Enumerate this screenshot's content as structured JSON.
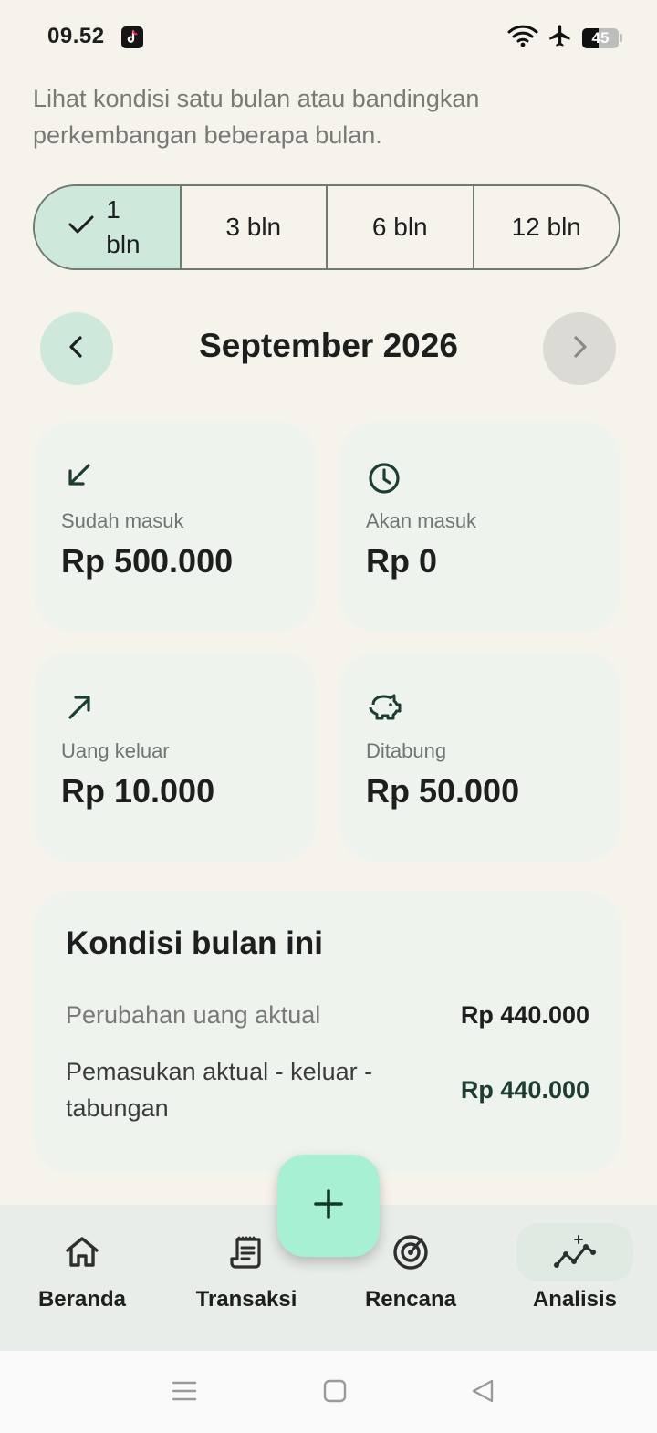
{
  "status_bar": {
    "time": "09.52",
    "battery": "45",
    "battery_level": 0.45
  },
  "description": "Lihat kondisi satu bulan atau bandingkan perkembangan beberapa bulan.",
  "range_selector": {
    "options": [
      {
        "label": "1 bln",
        "selected": true
      },
      {
        "label": "3 bln",
        "selected": false
      },
      {
        "label": "6 bln",
        "selected": false
      },
      {
        "label": "12 bln",
        "selected": false
      }
    ]
  },
  "month_nav": {
    "title": "September 2026",
    "prev_icon": "chevron-left-icon",
    "next_icon": "chevron-right-icon"
  },
  "stats": [
    {
      "icon": "arrow-down-left-icon",
      "label": "Sudah masuk",
      "value": "Rp 500.000"
    },
    {
      "icon": "clock-icon",
      "label": "Akan masuk",
      "value": "Rp 0"
    },
    {
      "icon": "arrow-up-right-icon",
      "label": "Uang keluar",
      "value": "Rp 10.000"
    },
    {
      "icon": "piggy-bank-icon",
      "label": "Ditabung",
      "value": "Rp 50.000"
    }
  ],
  "summary": {
    "title": "Kondisi bulan ini",
    "rows": [
      {
        "label": "Perubahan uang aktual",
        "value": "Rp 440.000"
      },
      {
        "label": "Pemasukan aktual - keluar - tabungan",
        "value": "Rp 440.000"
      }
    ]
  },
  "bottom_nav": {
    "items": [
      {
        "label": "Beranda",
        "icon": "home-icon"
      },
      {
        "label": "Transaksi",
        "icon": "receipt-icon"
      },
      {
        "label": "Rencana",
        "icon": "target-icon"
      },
      {
        "label": "Analisis",
        "icon": "chart-icon",
        "active": true
      }
    ],
    "fab_icon": "plus-icon"
  },
  "colors": {
    "background": "#f6f3ec",
    "accent": "#cfe8dc",
    "fab": "#a8f0d2",
    "card": "#eef3ee",
    "dark_green": "#1d3d30"
  }
}
